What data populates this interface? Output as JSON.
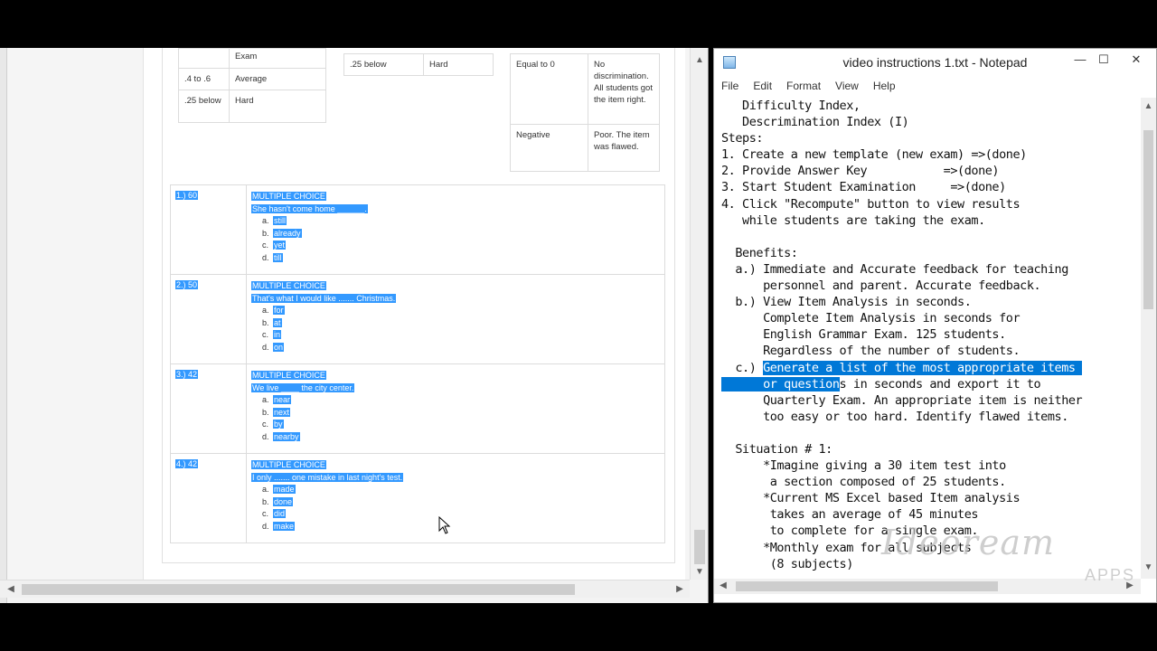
{
  "browser": {
    "upper_table_left": {
      "rows": [
        {
          "range": "",
          "label": "Exam"
        },
        {
          "range": ".4 to .6",
          "label": "Average"
        },
        {
          "range": ".25 below",
          "label": "Hard"
        }
      ]
    },
    "upper_table_mid": {
      "rows": [
        {
          "range": ".25 below",
          "label": "Hard"
        }
      ]
    },
    "upper_table_right": {
      "rows": [
        {
          "range": "Equal to 0",
          "label": "No discrimination. All students got the item right."
        },
        {
          "range": "Negative",
          "label": "Poor. The item was flawed."
        }
      ]
    },
    "questions": [
      {
        "number": "1.) 60",
        "type": "MULTIPLE CHOICE",
        "text": "She hasn't come home ______.",
        "options": [
          {
            "letter": "a.",
            "text": "still"
          },
          {
            "letter": "b.",
            "text": "already"
          },
          {
            "letter": "c.",
            "text": "yet"
          },
          {
            "letter": "d.",
            "text": "till"
          }
        ]
      },
      {
        "number": "2.) 50",
        "type": "MULTIPLE CHOICE",
        "text": "That's what I would like ....... Christmas.",
        "options": [
          {
            "letter": "a.",
            "text": "for"
          },
          {
            "letter": "b.",
            "text": "at"
          },
          {
            "letter": "c.",
            "text": "in"
          },
          {
            "letter": "d.",
            "text": "on"
          }
        ]
      },
      {
        "number": "3.) 42",
        "type": "MULTIPLE CHOICE",
        "text": "We live ____ the city center.",
        "options": [
          {
            "letter": "a.",
            "text": "near"
          },
          {
            "letter": "b.",
            "text": "next"
          },
          {
            "letter": "c.",
            "text": "by"
          },
          {
            "letter": "d.",
            "text": "nearby"
          }
        ]
      },
      {
        "number": "4.) 42",
        "type": "MULTIPLE CHOICE",
        "text": "I only ....... one mistake in last night's test.",
        "options": [
          {
            "letter": "a.",
            "text": "made"
          },
          {
            "letter": "b.",
            "text": "done"
          },
          {
            "letter": "c.",
            "text": "did"
          },
          {
            "letter": "d.",
            "text": "make"
          }
        ]
      }
    ]
  },
  "notepad": {
    "title": "video instructions 1.txt - Notepad",
    "menu": [
      "File",
      "Edit",
      "Format",
      "View",
      "Help"
    ],
    "lines_before_highlight": "   Difficulty Index,\n   Descrimination Index (I)\nSteps:\n1. Create a new template (new exam) =>(done)\n2. Provide Answer Key           =>(done)\n3. Start Student Examination     =>(done)\n4. Click \"Recompute\" button to view results\n   while students are taking the exam.\n\n  Benefits:\n  a.) Immediate and Accurate feedback for teaching\n      personnel and parent. Accurate feedback.\n  b.) View Item Analysis in seconds.\n      Complete Item Analysis in seconds for\n      English Grammar Exam. 125 students.\n      Regardless of the number of students.\n  c.) ",
    "highlight_line1": "Generate a list of the most appropriate items ",
    "highlight_line2_prefix": "      or question",
    "lines_after_highlight": "s in seconds and export it to\n      Quarterly Exam. An appropriate item is neither\n      too easy or too hard. Identify flawed items.\n\n  Situation # 1:\n      *Imagine giving a 30 item test into\n       a section composed of 25 students.\n      *Current MS Excel based Item analysis\n       takes an average of 45 minutes\n       to complete for a single exam.\n      *Monthly exam for all subjects\n       (8 subjects)"
  },
  "watermark": {
    "text": "Ideoream",
    "sub": "APPS"
  },
  "icons": {
    "minimize": "minimize-icon",
    "maximize": "maximize-icon",
    "close": "close-icon"
  }
}
